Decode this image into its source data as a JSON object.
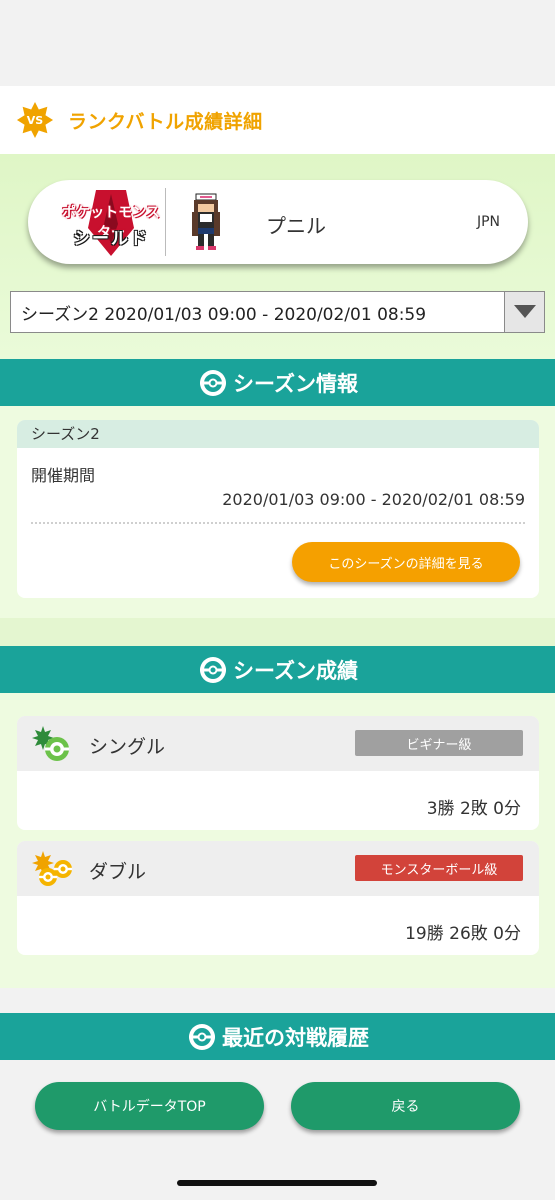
{
  "header": {
    "badge_text": "VS",
    "title": "ランクバトル成績詳細",
    "accent_color": "#f0a300"
  },
  "profile": {
    "game_logo_line1": "ポケットモンスター",
    "game_logo_line2": "シールド",
    "player_name": "プニル",
    "region": "JPN"
  },
  "season_select": {
    "value": "シーズン2 2020/01/03 09:00 - 2020/02/01 08:59"
  },
  "season_info": {
    "section_title": "シーズン情報",
    "season_name": "シーズン2",
    "period_label": "開催期間",
    "period_value": "2020/01/03 09:00 - 2020/02/01 08:59",
    "detail_button": "このシーズンの詳細を見る"
  },
  "season_results": {
    "section_title": "シーズン成績",
    "single": {
      "label": "シングル",
      "rank": "ビギナー級",
      "rank_color": "#a0a0a0",
      "score": "3勝 2敗 0分"
    },
    "double": {
      "label": "ダブル",
      "rank": "モンスターボール級",
      "rank_color": "#d2433a",
      "score": "19勝 26敗 0分"
    }
  },
  "recent_battles": {
    "section_title": "最近の対戦履歴"
  },
  "footer": {
    "top_button": "バトルデータTOP",
    "back_button": "戻る"
  },
  "colors": {
    "teal": "#1aa39a",
    "button_green": "#1f9a6a",
    "orange_button": "#f5a000"
  }
}
